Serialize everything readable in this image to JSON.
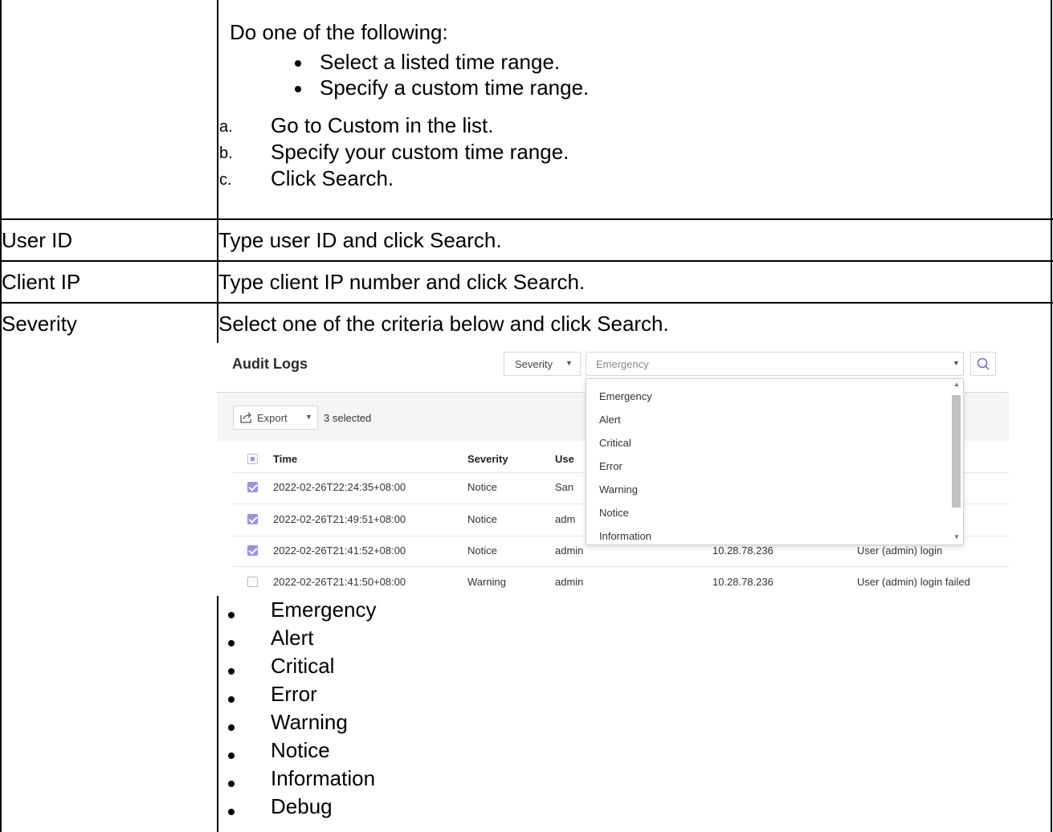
{
  "row1": {
    "intro": "Do one of the following:",
    "bullets": [
      "Select a listed time range.",
      "Specify a custom time range."
    ],
    "steps": [
      {
        "letter": "a.",
        "text": "Go to Custom in the list."
      },
      {
        "letter": "b.",
        "text": "Specify your custom time range."
      },
      {
        "letter": "c.",
        "text": "Click Search."
      }
    ]
  },
  "row2": {
    "label": "User ID",
    "text": "Type user ID and click Search."
  },
  "row3": {
    "label": "Client IP",
    "text": "Type client IP number and click Search."
  },
  "row4": {
    "label": "Severity",
    "text": "Select one of the criteria below and click Search.",
    "bullets": [
      "Emergency",
      "Alert",
      "Critical",
      "Error",
      "Warning",
      "Notice",
      "Information",
      "Debug"
    ]
  },
  "screenshot": {
    "title": "Audit Logs",
    "filter_field": "Severity",
    "filter_value": "Emergency",
    "export_label": "Export",
    "selected_count": "3 selected",
    "columns": [
      "Time",
      "Severity",
      "Use"
    ],
    "rows": [
      {
        "time": "2022-02-26T22:24:35+08:00",
        "severity": "Notice",
        "user": "San",
        "ip": "",
        "message": "",
        "checked": true
      },
      {
        "time": "2022-02-26T21:49:51+08:00",
        "severity": "Notice",
        "user": "adm",
        "ip": "",
        "message": "",
        "checked": true
      },
      {
        "time": "2022-02-26T21:41:52+08:00",
        "severity": "Notice",
        "user": "admin",
        "ip": "10.28.78.236",
        "message": "User (admin) login",
        "checked": true
      },
      {
        "time": "2022-02-26T21:41:50+08:00",
        "severity": "Warning",
        "user": "admin",
        "ip": "10.28.78.236",
        "message": "User (admin) login failed",
        "checked": false
      }
    ],
    "dropdown_options": [
      "Emergency",
      "Alert",
      "Critical",
      "Error",
      "Warning",
      "Notice",
      "Information"
    ],
    "accent_color": "#9e8cf0",
    "icons": {
      "search": "search-icon",
      "export": "export-icon",
      "caret": "caret-down-icon"
    }
  }
}
